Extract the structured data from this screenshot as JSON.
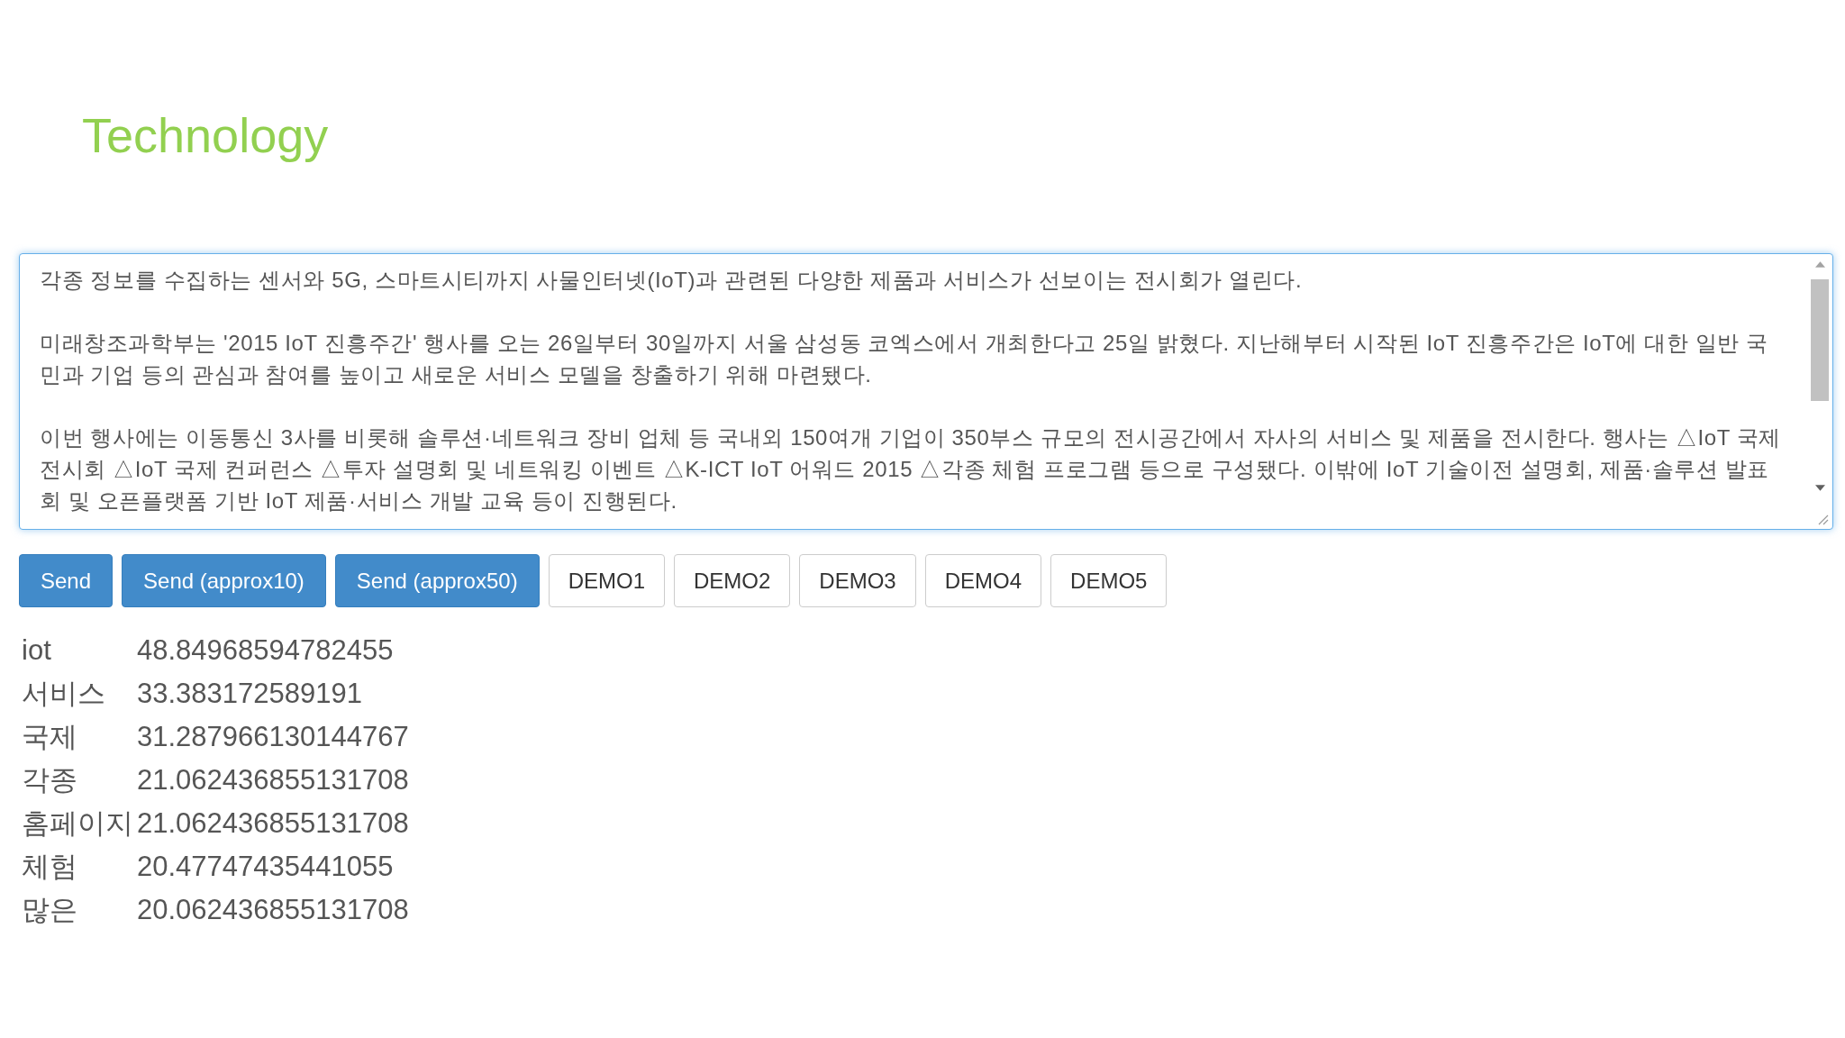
{
  "page": {
    "title": "Technology"
  },
  "text_input": {
    "focused": true,
    "paragraphs": [
      "각종 정보를 수집하는 센서와 5G, 스마트시티까지 사물인터넷(IoT)과 관련된 다양한 제품과 서비스가 선보이는 전시회가 열린다.",
      "미래창조과학부는 '2015 IoT 진흥주간' 행사를 오는 26일부터 30일까지 서울 삼성동 코엑스에서 개최한다고 25일 밝혔다. 지난해부터 시작된 IoT 진흥주간은 IoT에 대한 일반 국민과 기업 등의 관심과 참여를 높이고 새로운 서비스 모델을 창출하기 위해 마련됐다.",
      "이번 행사에는 이동통신 3사를 비롯해 솔루션·네트워크 장비 업체 등 국내외 150여개 기업이 350부스 규모의 전시공간에서 자사의 서비스 및 제품을 전시한다. 행사는 △IoT 국제 전시회 △IoT 국제 컨퍼런스 △투자 설명회 및 네트워킹 이벤트 △K-ICT IoT 어워드 2015 △각종 체험 프로그램 등으로 구성됐다. 이밖에 IoT 기술이전 설명회, 제품·솔루션 발표회 및 오픈플랫폼 기반 IoT 제품·서비스 개발 교육 등이 진행된다."
    ]
  },
  "buttons": [
    {
      "label": "Send",
      "kind": "primary"
    },
    {
      "label": "Send (approx10)",
      "kind": "primary"
    },
    {
      "label": "Send (approx50)",
      "kind": "primary"
    },
    {
      "label": "DEMO1",
      "kind": "default"
    },
    {
      "label": "DEMO2",
      "kind": "default"
    },
    {
      "label": "DEMO3",
      "kind": "default"
    },
    {
      "label": "DEMO4",
      "kind": "default"
    },
    {
      "label": "DEMO5",
      "kind": "default"
    }
  ],
  "results": [
    {
      "term": "iot",
      "score": "48.84968594782455"
    },
    {
      "term": "서비스",
      "score": "33.383172589191"
    },
    {
      "term": "국제",
      "score": "31.287966130144767"
    },
    {
      "term": "각종",
      "score": "21.062436855131708"
    },
    {
      "term": "홈페이지",
      "score": "21.062436855131708"
    },
    {
      "term": "체험",
      "score": "20.47747435441055"
    },
    {
      "term": "많은",
      "score": "20.062436855131708"
    }
  ]
}
